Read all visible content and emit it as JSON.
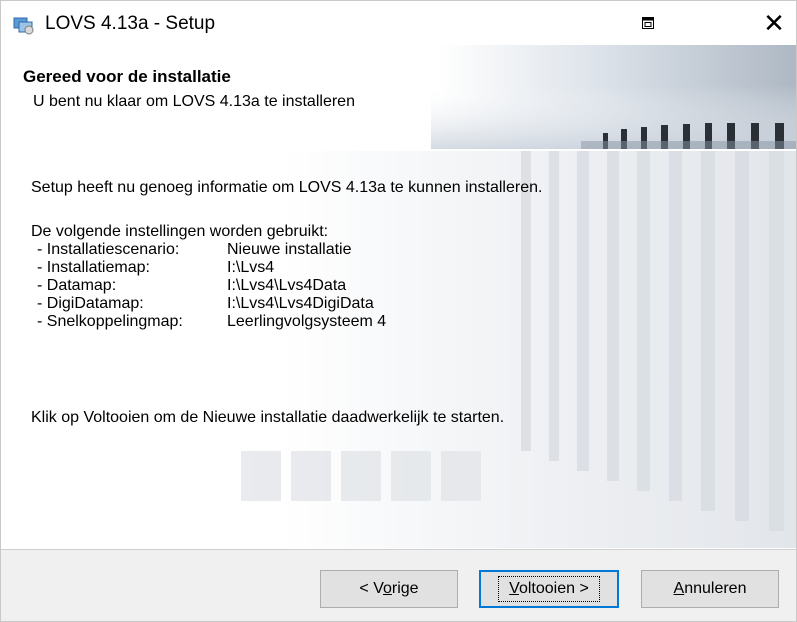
{
  "window": {
    "title": "LOVS 4.13a - Setup",
    "restore_icon": "restore-window-icon",
    "close_glyph": "✕"
  },
  "header": {
    "title": "Gereed voor de installatie",
    "subtitle": "U bent nu klaar om LOVS 4.13a te installeren"
  },
  "body": {
    "intro": "Setup heeft nu genoeg informatie om LOVS 4.13a te kunnen installeren.",
    "settings_heading": "De volgende instellingen worden gebruikt:",
    "settings": [
      {
        "label": "- Installatiescenario:",
        "value": "Nieuwe installatie"
      },
      {
        "label": "- Installatiemap:",
        "value": "I:\\Lvs4"
      },
      {
        "label": "- Datamap:",
        "value": "I:\\Lvs4\\Lvs4Data"
      },
      {
        "label": "- DigiDatamap:",
        "value": "I:\\Lvs4\\Lvs4DigiData"
      },
      {
        "label": "- Snelkoppelingmap:",
        "value": "Leerlingvolgsysteem 4"
      }
    ],
    "instruction": "Klik op Voltooien om de Nieuwe installatie daadwerkelijk te starten."
  },
  "buttons": {
    "prev_pre": "< V",
    "prev_accel": "o",
    "prev_post": "rige",
    "finish_accel": "V",
    "finish_post": "oltooien >",
    "cancel_accel": "A",
    "cancel_post": "nnuleren"
  }
}
